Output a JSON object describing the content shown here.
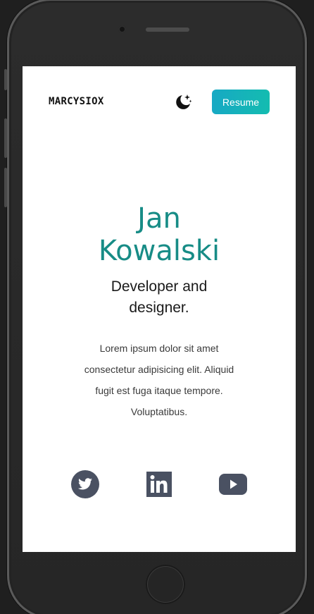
{
  "header": {
    "logo": "MARCYSIOX",
    "theme_toggle_icon": "moon-stars-icon",
    "resume_label": "Resume"
  },
  "hero": {
    "name_line1": "Jan",
    "name_line2": "Kowalski",
    "role_line1": "Developer and",
    "role_line2": "designer.",
    "description_lines": [
      "Lorem ipsum dolor sit amet",
      "consectetur adipisicing elit. Aliquid",
      "fugit est fuga itaque tempore.",
      "Voluptatibus."
    ]
  },
  "social": [
    {
      "icon": "twitter-icon"
    },
    {
      "icon": "linkedin-icon"
    },
    {
      "icon": "youtube-icon"
    }
  ],
  "colors": {
    "accent": "#178c86",
    "button_gradient_start": "#17a9c4",
    "button_gradient_end": "#14bcb0",
    "icon": "#4a5162",
    "device": "#262626"
  }
}
